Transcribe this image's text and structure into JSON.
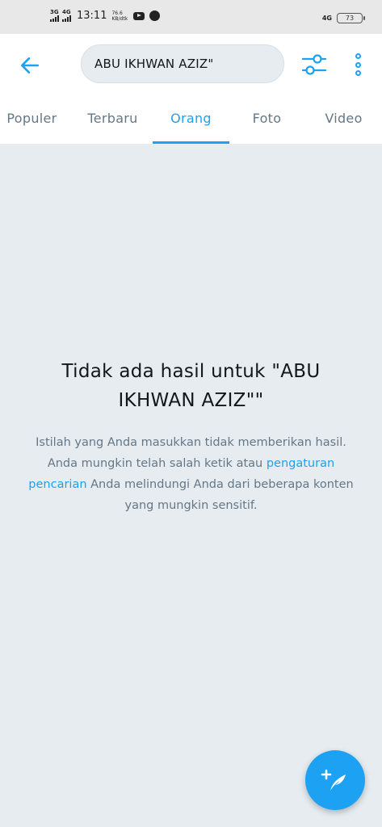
{
  "status_bar": {
    "net1": "3G",
    "net2": "4G",
    "time": "13:11",
    "speed_value": "76.6",
    "speed_unit": "KB/dtk",
    "lte": "4G",
    "battery": "73"
  },
  "header": {
    "search_value": "ABU IKHWAN AZIZ\"",
    "tabs": [
      {
        "label": "Populer"
      },
      {
        "label": "Terbaru"
      },
      {
        "label": "Orang"
      },
      {
        "label": "Foto"
      },
      {
        "label": "Video"
      }
    ],
    "active_tab": "Orang"
  },
  "empty_state": {
    "title": "Tidak ada hasil untuk \"ABU IKHWAN AZIZ\"\"",
    "desc_before": "Istilah yang Anda masukkan tidak memberikan hasil. Anda mungkin telah salah ketik atau ",
    "desc_link": "pengaturan pencarian",
    "desc_after": " Anda melindungi Anda dari beberapa konten yang mungkin sensitif."
  },
  "colors": {
    "accent": "#1da1f2",
    "background": "#e6ecf0",
    "header_bg": "#ffffff",
    "muted_text": "#657786"
  },
  "icons": {
    "back": "arrow-left-icon",
    "filter": "sliders-icon",
    "more": "more-vertical-icon",
    "compose": "compose-tweet-icon"
  }
}
